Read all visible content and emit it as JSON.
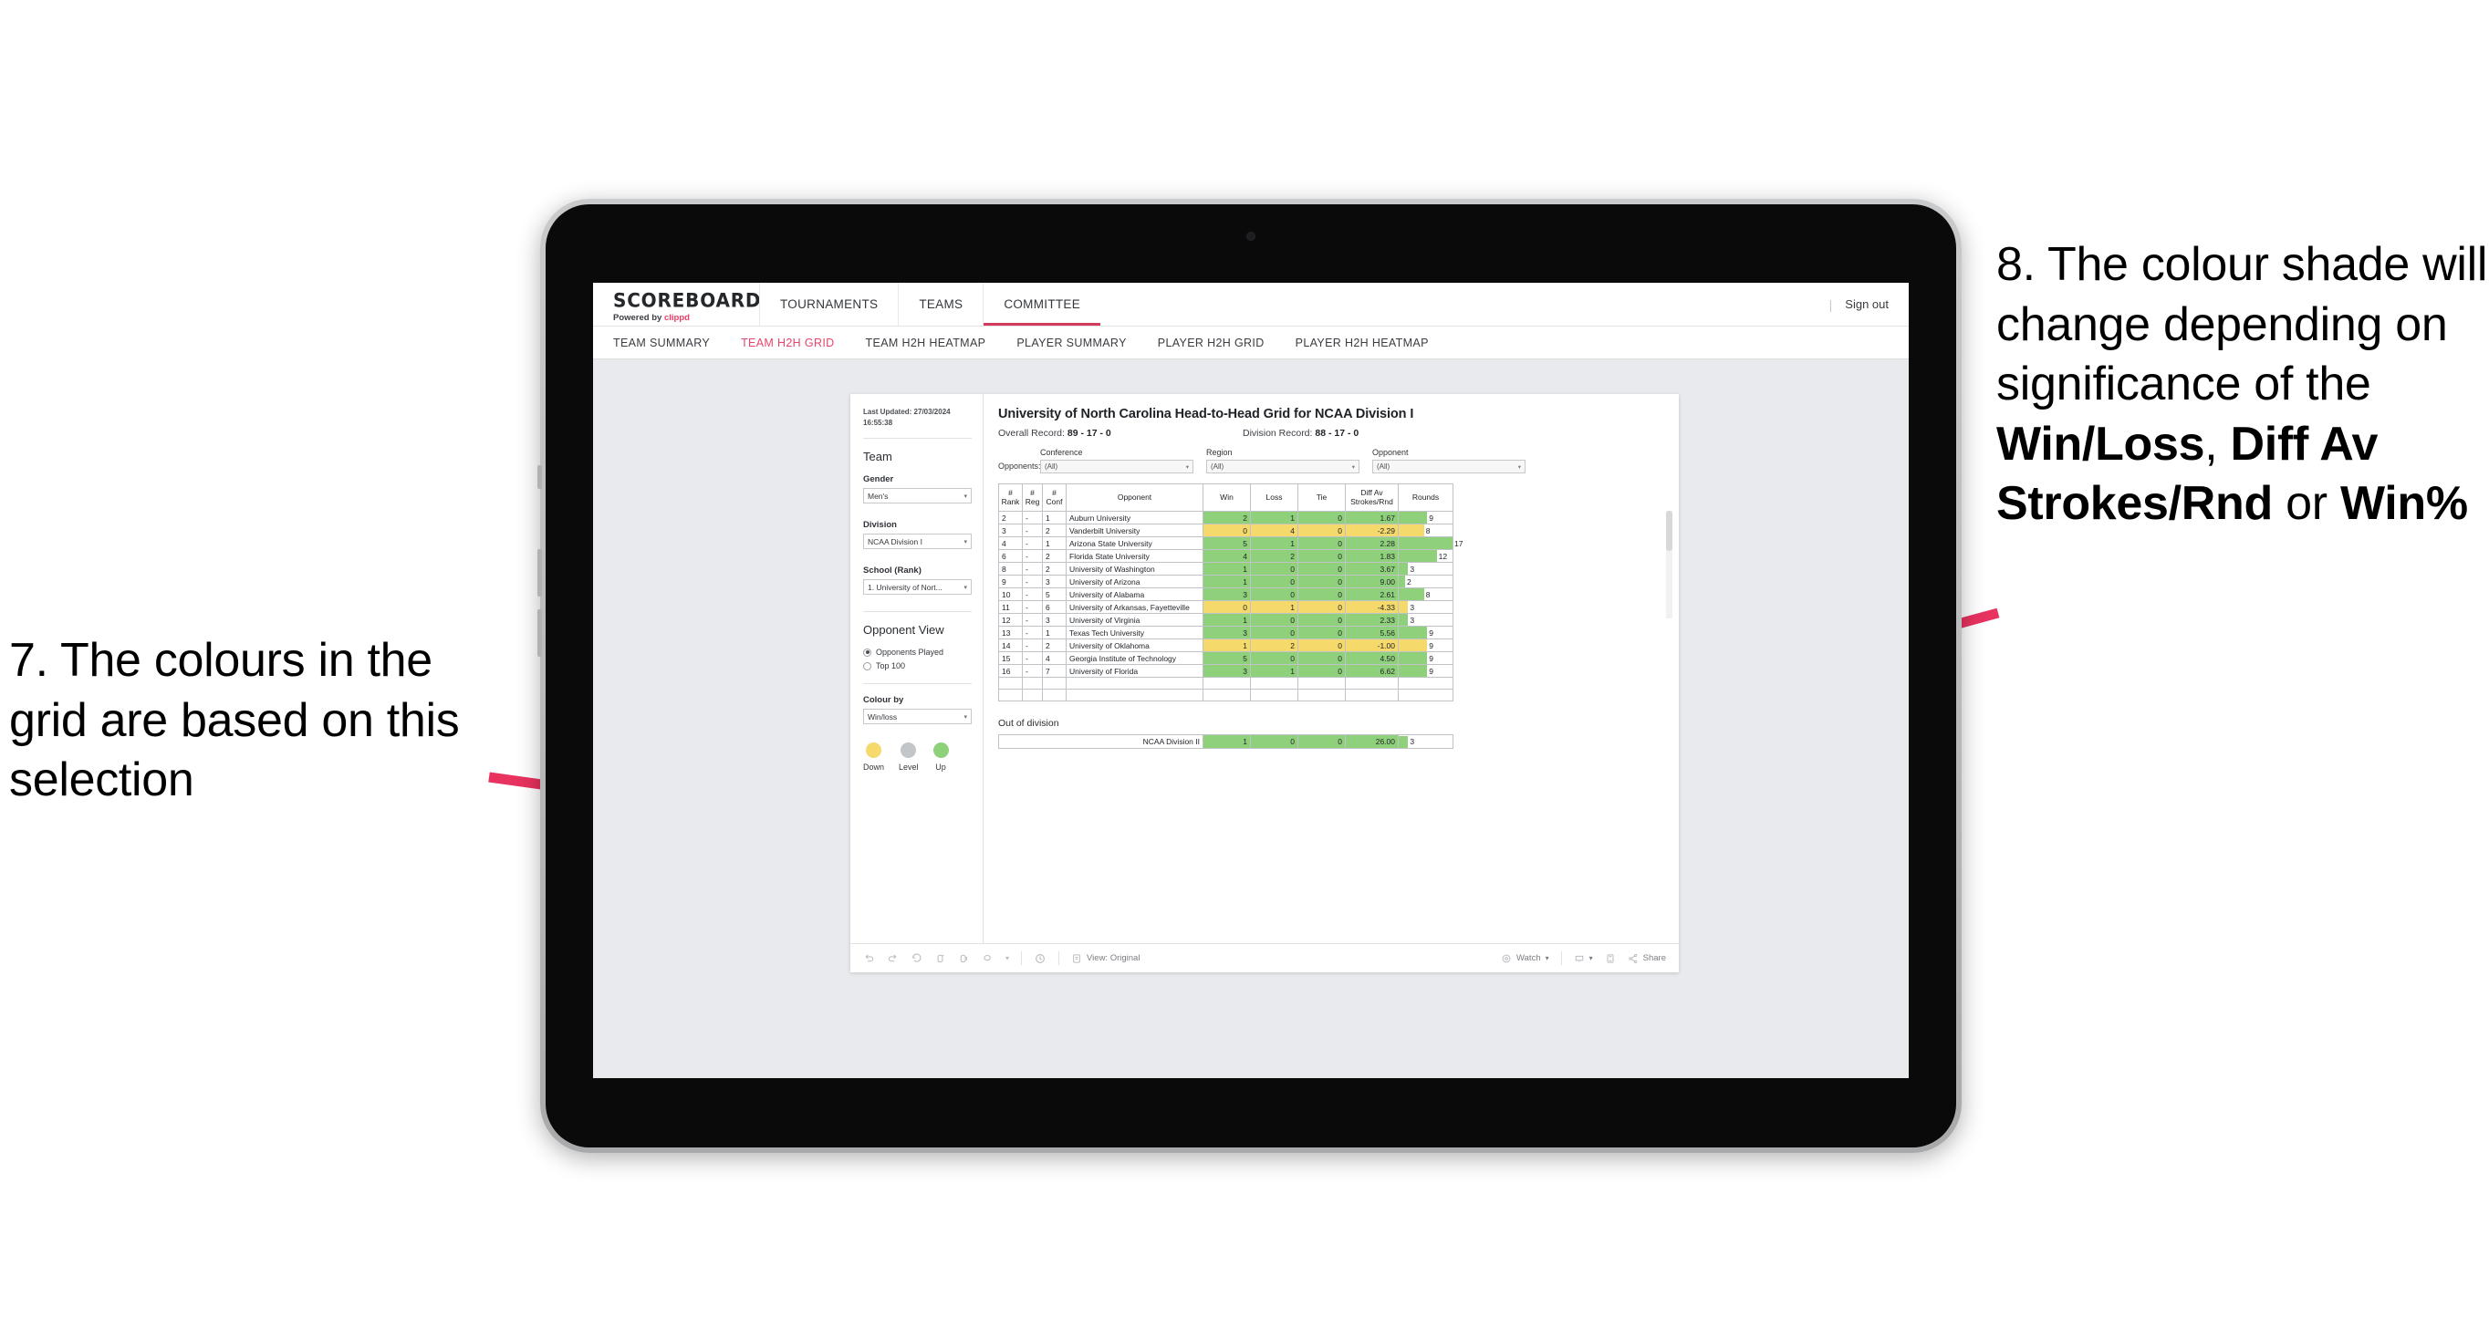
{
  "annotations": {
    "left": {
      "number": "7.",
      "text": "7. The colours in the grid are based on this selection"
    },
    "right": {
      "part1": "8. The colour shade will change depending on significance of the ",
      "bold1": "Win/Loss",
      "sep1": ", ",
      "bold2": "Diff Av Strokes/Rnd",
      "sep2": " or ",
      "bold3": "Win%"
    },
    "arrow_color": "#e8325f"
  },
  "app": {
    "brand": {
      "logo": "SCOREBOARD",
      "powered_prefix": "Powered by ",
      "powered_brand": "clippd"
    },
    "main_nav": [
      {
        "label": "TOURNAMENTS",
        "active": false
      },
      {
        "label": "TEAMS",
        "active": false
      },
      {
        "label": "COMMITTEE",
        "active": true
      }
    ],
    "sign_out": "Sign out",
    "sub_nav": [
      {
        "label": "TEAM SUMMARY",
        "active": false
      },
      {
        "label": "TEAM H2H GRID",
        "active": true
      },
      {
        "label": "TEAM H2H HEATMAP",
        "active": false
      },
      {
        "label": "PLAYER SUMMARY",
        "active": false
      },
      {
        "label": "PLAYER H2H GRID",
        "active": false
      },
      {
        "label": "PLAYER H2H HEATMAP",
        "active": false
      }
    ]
  },
  "filters": {
    "last_updated": "Last Updated: 27/03/2024 16:55:38",
    "team_title": "Team",
    "gender_label": "Gender",
    "gender_value": "Men's",
    "division_label": "Division",
    "division_value": "NCAA Division I",
    "school_label": "School (Rank)",
    "school_value": "1. University of Nort...",
    "opponent_view_title": "Opponent View",
    "opponent_view_options": [
      {
        "label": "Opponents Played",
        "selected": true
      },
      {
        "label": "Top 100",
        "selected": false
      }
    ],
    "colour_by_label": "Colour by",
    "colour_by_value": "Win/loss",
    "legend": [
      {
        "label": "Down",
        "color": "#f5d96b"
      },
      {
        "label": "Level",
        "color": "#c3c6c9"
      },
      {
        "label": "Up",
        "color": "#8fd07a"
      }
    ]
  },
  "viz": {
    "title": "University of North Carolina Head-to-Head Grid for NCAA Division I",
    "overall_record_label": "Overall Record: ",
    "overall_record_value": "89 - 17 - 0",
    "division_record_label": "Division Record: ",
    "division_record_value": "88 - 17 - 0",
    "opponents_label": "Opponents:",
    "opponent_filters": [
      {
        "label": "Conference",
        "value": "(All)"
      },
      {
        "label": "Region",
        "value": "(All)"
      },
      {
        "label": "Opponent",
        "value": "(All)"
      }
    ]
  },
  "chart_data": {
    "type": "table",
    "title": "University of North Carolina Head-to-Head Grid for NCAA Division I",
    "columns": [
      "# Rank",
      "# Reg",
      "# Conf",
      "Opponent",
      "Win",
      "Loss",
      "Tie",
      "Diff Av Strokes/Rnd",
      "Rounds"
    ],
    "column_headers_multiline": [
      [
        "#",
        "Rank"
      ],
      [
        "#",
        "Reg"
      ],
      [
        "#",
        "Conf"
      ],
      [
        "Opponent"
      ],
      [
        "Win"
      ],
      [
        "Loss"
      ],
      [
        "Tie"
      ],
      [
        "Diff Av",
        "Strokes/Rnd"
      ],
      [
        "Rounds"
      ]
    ],
    "rounds_max": 17,
    "colors": {
      "up": "#8fd07a",
      "down": "#f5d96b",
      "level": "#c3c6c9"
    },
    "rows": [
      {
        "rank": "2",
        "reg": "-",
        "conf": "1",
        "opponent": "Auburn University",
        "win": "2",
        "loss": "1",
        "tie": "0",
        "diff": "1.67",
        "rounds": "9",
        "state": "up"
      },
      {
        "rank": "3",
        "reg": "-",
        "conf": "2",
        "opponent": "Vanderbilt University",
        "win": "0",
        "loss": "4",
        "tie": "0",
        "diff": "-2.29",
        "rounds": "8",
        "state": "down"
      },
      {
        "rank": "4",
        "reg": "-",
        "conf": "1",
        "opponent": "Arizona State University",
        "win": "5",
        "loss": "1",
        "tie": "0",
        "diff": "2.28",
        "rounds": "17",
        "state": "up"
      },
      {
        "rank": "6",
        "reg": "-",
        "conf": "2",
        "opponent": "Florida State University",
        "win": "4",
        "loss": "2",
        "tie": "0",
        "diff": "1.83",
        "rounds": "12",
        "state": "up"
      },
      {
        "rank": "8",
        "reg": "-",
        "conf": "2",
        "opponent": "University of Washington",
        "win": "1",
        "loss": "0",
        "tie": "0",
        "diff": "3.67",
        "rounds": "3",
        "state": "up"
      },
      {
        "rank": "9",
        "reg": "-",
        "conf": "3",
        "opponent": "University of Arizona",
        "win": "1",
        "loss": "0",
        "tie": "0",
        "diff": "9.00",
        "rounds": "2",
        "state": "up"
      },
      {
        "rank": "10",
        "reg": "-",
        "conf": "5",
        "opponent": "University of Alabama",
        "win": "3",
        "loss": "0",
        "tie": "0",
        "diff": "2.61",
        "rounds": "8",
        "state": "up"
      },
      {
        "rank": "11",
        "reg": "-",
        "conf": "6",
        "opponent": "University of Arkansas, Fayetteville",
        "win": "0",
        "loss": "1",
        "tie": "0",
        "diff": "-4.33",
        "rounds": "3",
        "state": "down"
      },
      {
        "rank": "12",
        "reg": "-",
        "conf": "3",
        "opponent": "University of Virginia",
        "win": "1",
        "loss": "0",
        "tie": "0",
        "diff": "2.33",
        "rounds": "3",
        "state": "up"
      },
      {
        "rank": "13",
        "reg": "-",
        "conf": "1",
        "opponent": "Texas Tech University",
        "win": "3",
        "loss": "0",
        "tie": "0",
        "diff": "5.56",
        "rounds": "9",
        "state": "up"
      },
      {
        "rank": "14",
        "reg": "-",
        "conf": "2",
        "opponent": "University of Oklahoma",
        "win": "1",
        "loss": "2",
        "tie": "0",
        "diff": "-1.00",
        "rounds": "9",
        "state": "down"
      },
      {
        "rank": "15",
        "reg": "-",
        "conf": "4",
        "opponent": "Georgia Institute of Technology",
        "win": "5",
        "loss": "0",
        "tie": "0",
        "diff": "4.50",
        "rounds": "9",
        "state": "up"
      },
      {
        "rank": "16",
        "reg": "-",
        "conf": "7",
        "opponent": "University of Florida",
        "win": "3",
        "loss": "1",
        "tie": "0",
        "diff": "6.62",
        "rounds": "9",
        "state": "up"
      }
    ],
    "out_of_division_title": "Out of division",
    "out_of_division_rows": [
      {
        "opponent": "NCAA Division II",
        "win": "1",
        "loss": "0",
        "tie": "0",
        "diff": "26.00",
        "rounds": "3",
        "state": "up"
      }
    ]
  },
  "toolbar": {
    "view_label": "View: Original",
    "watch_label": "Watch",
    "share_label": "Share",
    "icons": [
      "undo-icon",
      "redo-icon",
      "revert-icon",
      "refresh-icon",
      "pause-icon",
      "zoom-icon",
      "history-icon",
      "view-icon",
      "watch-icon",
      "download-icon",
      "fullscreen-icon",
      "share-icon"
    ]
  }
}
